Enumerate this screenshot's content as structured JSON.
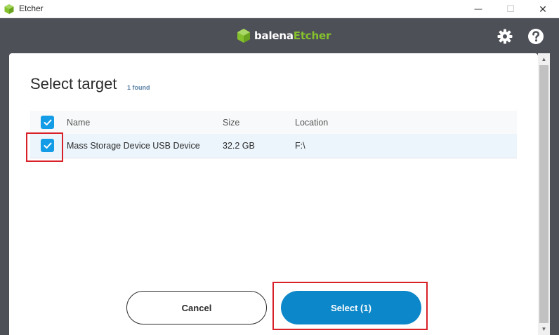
{
  "window": {
    "title": "Etcher",
    "minimize_glyph": "—",
    "maximize_glyph": "☐",
    "close_glyph": "✕"
  },
  "header": {
    "brand_prefix": "balena",
    "brand_suffix": "Etcher",
    "icons": [
      "settings-gear-icon",
      "help-question-icon"
    ]
  },
  "modal": {
    "title": "Select target",
    "count": "1 found",
    "columns": {
      "name": "Name",
      "size": "Size",
      "location": "Location"
    },
    "rows": [
      {
        "name": "Mass Storage Device USB Device",
        "size": "32.2 GB",
        "location": "F:\\",
        "selected": true
      }
    ],
    "cancel_label": "Cancel",
    "select_label": "Select (1)"
  },
  "colors": {
    "header_bg": "#4d5057",
    "accent_blue": "#0c87c9",
    "checkbox_blue": "#159ce6",
    "brand_green": "#85c12d",
    "highlight_red": "#d92028",
    "selected_row": "#ecf5fc"
  }
}
